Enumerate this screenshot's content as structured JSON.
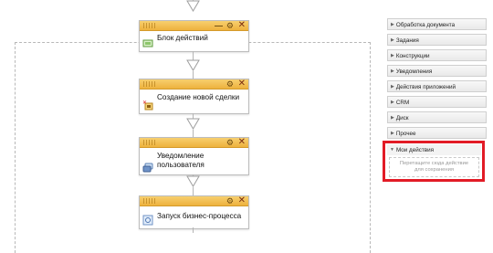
{
  "workflow": {
    "blocks": [
      {
        "title": "Блок действий",
        "icon": "action-block-icon"
      },
      {
        "title": "Создание новой сделки",
        "icon": "new-deal-icon"
      },
      {
        "title_line1": "Уведомление",
        "title_line2": "пользователя",
        "icon": "user-notify-icon"
      },
      {
        "title": "Запуск бизнес-процесса",
        "icon": "start-process-icon"
      }
    ],
    "header_buttons": {
      "minimize": "—",
      "settings": "⚙",
      "close": "✕"
    }
  },
  "panel": {
    "items": [
      {
        "label": "Обработка документа"
      },
      {
        "label": "Задания"
      },
      {
        "label": "Конструкции"
      },
      {
        "label": "Уведомления"
      },
      {
        "label": "Действия приложений"
      },
      {
        "label": "CRM"
      },
      {
        "label": "Диск"
      },
      {
        "label": "Прочее"
      }
    ],
    "my_actions": {
      "label": "Мои действия",
      "drop_line1": "Перетащите сюда действие",
      "drop_line2": "для сохранения"
    }
  },
  "colors": {
    "block_header": "#eeb23e",
    "highlight": "#e21b26"
  }
}
